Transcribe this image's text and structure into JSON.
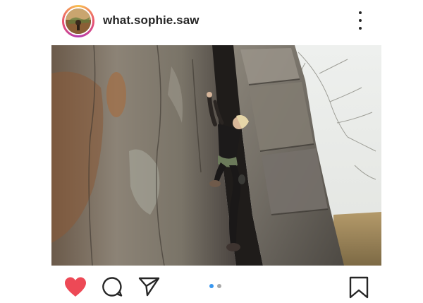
{
  "post": {
    "username": "what.sophie.saw",
    "liked": true,
    "carousel": {
      "total": 2,
      "current": 1
    }
  },
  "icons": {
    "more": "more-vertical-icon",
    "like": "heart-icon",
    "comment": "comment-icon",
    "share": "send-icon",
    "save": "bookmark-icon"
  },
  "colors": {
    "like_active": "#ed4956",
    "carousel_active": "#3897f0",
    "carousel_inactive": "#a8a8a8",
    "text": "#262626"
  }
}
